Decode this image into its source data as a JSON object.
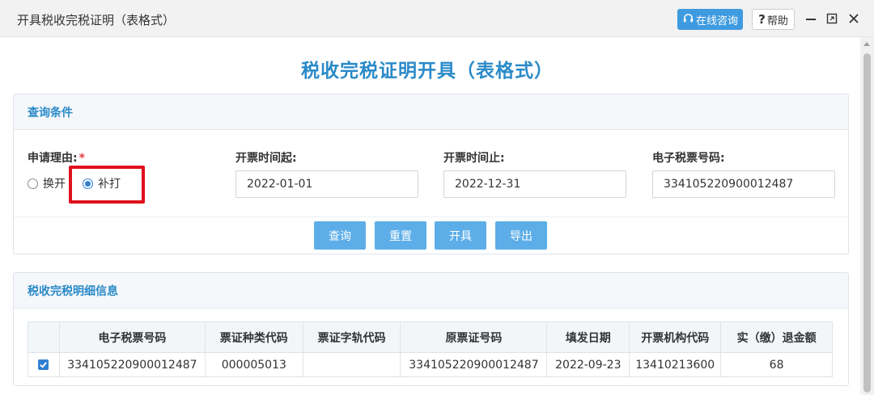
{
  "window": {
    "title": "开具税收完税证明（表格式）",
    "online_consult": "在线咨询",
    "help": "帮助",
    "help_prefix": "?"
  },
  "page": {
    "title": "税收完税证明开具（表格式）"
  },
  "query": {
    "section_title": "查询条件",
    "reason": {
      "label": "申请理由:",
      "required_mark": "*",
      "options": [
        {
          "label": "换开",
          "selected": false
        },
        {
          "label": "补打",
          "selected": true
        }
      ]
    },
    "start_date": {
      "label": "开票时间起:",
      "value": "2022-01-01"
    },
    "end_date": {
      "label": "开票时间止:",
      "value": "2022-12-31"
    },
    "ticket_no": {
      "label": "电子税票号码:",
      "value": "334105220900012487"
    },
    "buttons": {
      "search": "查询",
      "reset": "重置",
      "issue": "开具",
      "export": "导出"
    }
  },
  "detail": {
    "section_title": "税收完税明细信息",
    "columns": [
      "电子税票号码",
      "票证种类代码",
      "票证字轨代码",
      "原票证号码",
      "填发日期",
      "开票机构代码",
      "实（缴）退金额"
    ],
    "rows": [
      {
        "checked": true,
        "cells": [
          "334105220900012487",
          "000005013",
          "",
          "334105220900012487",
          "2022-09-23",
          "13410213600",
          "68"
        ]
      }
    ]
  },
  "colors": {
    "accent": "#2a8ac8",
    "button": "#5daee8",
    "highlight": "#e0101d",
    "required": "#e23b3b"
  }
}
